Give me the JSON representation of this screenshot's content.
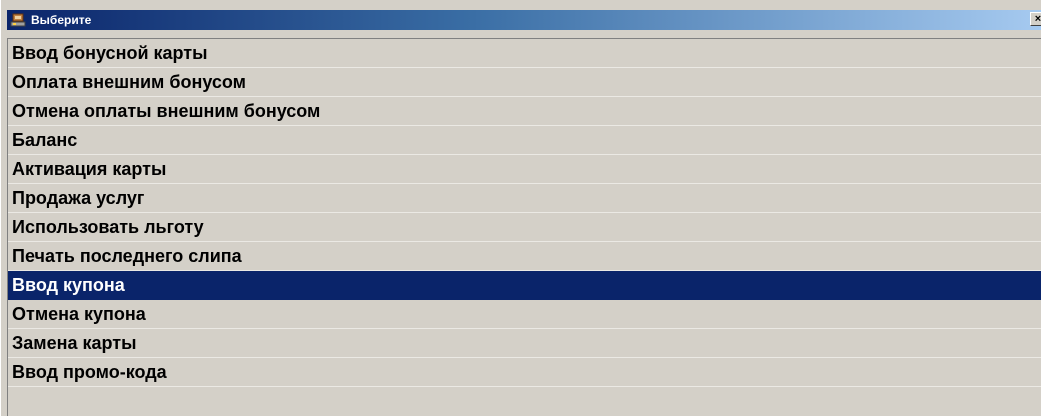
{
  "window": {
    "title": "Выберите",
    "close_label": "×",
    "selected_index": 8,
    "colors": {
      "title_bar": "#0a246a",
      "background": "#d4d0c8",
      "selection": "#0a246a"
    }
  },
  "menu": {
    "items": [
      {
        "label": "Ввод бонусной карты"
      },
      {
        "label": "Оплата внешним бонусом"
      },
      {
        "label": "Отмена оплаты внешним бонусом"
      },
      {
        "label": "Баланс"
      },
      {
        "label": "Активация карты"
      },
      {
        "label": "Продажа услуг"
      },
      {
        "label": "Использовать льготу"
      },
      {
        "label": "Печать последнего слипа"
      },
      {
        "label": "Ввод купона"
      },
      {
        "label": "Отмена купона"
      },
      {
        "label": "Замена карты"
      },
      {
        "label": "Ввод промо-кода"
      }
    ]
  }
}
